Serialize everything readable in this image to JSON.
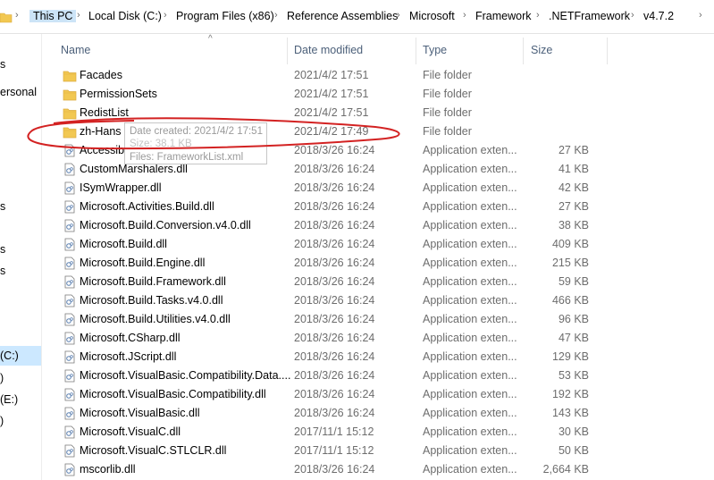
{
  "breadcrumb": [
    "This PC",
    "Local Disk (C:)",
    "Program Files (x86)",
    "Reference Assemblies",
    "Microsoft",
    "Framework",
    ".NETFramework",
    "v4.7.2"
  ],
  "nav": {
    "items": [
      "s",
      "ersonal",
      "s",
      "s",
      "s",
      "(C:)",
      ")",
      "(E:)",
      ")"
    ]
  },
  "columns": {
    "name": "Name",
    "date": "Date modified",
    "type": "Type",
    "size": "Size"
  },
  "rows": [
    {
      "name": "Facades",
      "date": "2021/4/2 17:51",
      "type": "File folder",
      "size": "",
      "icon": "folder-icon"
    },
    {
      "name": "PermissionSets",
      "date": "2021/4/2 17:51",
      "type": "File folder",
      "size": "",
      "icon": "folder-icon"
    },
    {
      "name": "RedistList",
      "date": "2021/4/2 17:51",
      "type": "File folder",
      "size": "",
      "icon": "folder-icon"
    },
    {
      "name": "zh-Hans",
      "date": "2021/4/2 17:49",
      "type": "File folder",
      "size": "",
      "icon": "folder-icon"
    },
    {
      "name": "Accessibility.dll",
      "date": "2018/3/26 16:24",
      "type": "Application exten...",
      "size": "27 KB",
      "icon": "dll-icon"
    },
    {
      "name": "CustomMarshalers.dll",
      "date": "2018/3/26 16:24",
      "type": "Application exten...",
      "size": "41 KB",
      "icon": "dll-icon"
    },
    {
      "name": "ISymWrapper.dll",
      "date": "2018/3/26 16:24",
      "type": "Application exten...",
      "size": "42 KB",
      "icon": "dll-icon"
    },
    {
      "name": "Microsoft.Activities.Build.dll",
      "date": "2018/3/26 16:24",
      "type": "Application exten...",
      "size": "27 KB",
      "icon": "dll-icon"
    },
    {
      "name": "Microsoft.Build.Conversion.v4.0.dll",
      "date": "2018/3/26 16:24",
      "type": "Application exten...",
      "size": "38 KB",
      "icon": "dll-icon"
    },
    {
      "name": "Microsoft.Build.dll",
      "date": "2018/3/26 16:24",
      "type": "Application exten...",
      "size": "409 KB",
      "icon": "dll-icon"
    },
    {
      "name": "Microsoft.Build.Engine.dll",
      "date": "2018/3/26 16:24",
      "type": "Application exten...",
      "size": "215 KB",
      "icon": "dll-icon"
    },
    {
      "name": "Microsoft.Build.Framework.dll",
      "date": "2018/3/26 16:24",
      "type": "Application exten...",
      "size": "59 KB",
      "icon": "dll-icon"
    },
    {
      "name": "Microsoft.Build.Tasks.v4.0.dll",
      "date": "2018/3/26 16:24",
      "type": "Application exten...",
      "size": "466 KB",
      "icon": "dll-icon"
    },
    {
      "name": "Microsoft.Build.Utilities.v4.0.dll",
      "date": "2018/3/26 16:24",
      "type": "Application exten...",
      "size": "96 KB",
      "icon": "dll-icon"
    },
    {
      "name": "Microsoft.CSharp.dll",
      "date": "2018/3/26 16:24",
      "type": "Application exten...",
      "size": "47 KB",
      "icon": "dll-icon"
    },
    {
      "name": "Microsoft.JScript.dll",
      "date": "2018/3/26 16:24",
      "type": "Application exten...",
      "size": "129 KB",
      "icon": "dll-icon"
    },
    {
      "name": "Microsoft.VisualBasic.Compatibility.Data....",
      "date": "2018/3/26 16:24",
      "type": "Application exten...",
      "size": "53 KB",
      "icon": "dll-icon"
    },
    {
      "name": "Microsoft.VisualBasic.Compatibility.dll",
      "date": "2018/3/26 16:24",
      "type": "Application exten...",
      "size": "192 KB",
      "icon": "dll-icon"
    },
    {
      "name": "Microsoft.VisualBasic.dll",
      "date": "2018/3/26 16:24",
      "type": "Application exten...",
      "size": "143 KB",
      "icon": "dll-icon"
    },
    {
      "name": "Microsoft.VisualC.dll",
      "date": "2017/11/1 15:12",
      "type": "Application exten...",
      "size": "30 KB",
      "icon": "dll-icon"
    },
    {
      "name": "Microsoft.VisualC.STLCLR.dll",
      "date": "2017/11/1 15:12",
      "type": "Application exten...",
      "size": "50 KB",
      "icon": "dll-icon"
    },
    {
      "name": "mscorlib.dll",
      "date": "2018/3/26 16:24",
      "type": "Application exten...",
      "size": "2,664 KB",
      "icon": "dll-icon"
    }
  ],
  "tooltip": {
    "created": "Date created: 2021/4/2 17:51",
    "size": "Size: 38.1 KB",
    "files": "Files: FrameworkList.xml"
  },
  "colors": {
    "accent": "#cce4f7",
    "annotation": "#d32222",
    "folder": "#f2c852"
  }
}
